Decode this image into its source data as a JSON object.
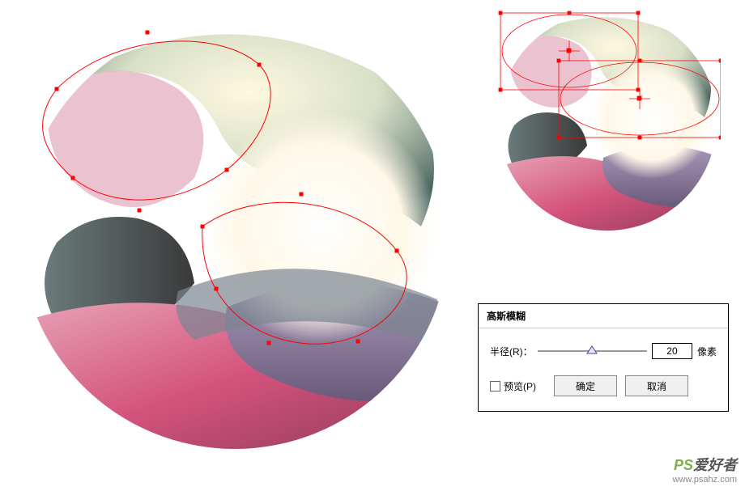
{
  "dialog": {
    "title": "高斯模糊",
    "radius_label": "半径(R)：",
    "radius_value": "20",
    "unit": "像素",
    "preview_label": "预览(P)",
    "ok_label": "确定",
    "cancel_label": "取消"
  },
  "watermark": {
    "brand_ps": "PS",
    "brand_rest": "爱好者",
    "url": "www.psahz.com"
  }
}
